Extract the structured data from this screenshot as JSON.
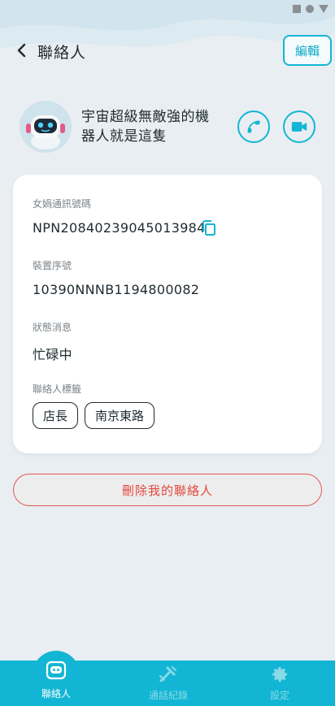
{
  "header": {
    "title": "聯絡人",
    "edit_label": "編輯"
  },
  "profile": {
    "name": "宇宙超級無敵強的機器人就是這隻"
  },
  "details": {
    "id_label": "女媧通訊號碼",
    "id_value": "NPN20840239045013984",
    "serial_label": "裝置序號",
    "serial_value": "10390NNNB1194800082",
    "status_label": "狀態消息",
    "status_value": "忙碌中",
    "tags_label": "聯絡人標籤",
    "tags": [
      "店長",
      "南京東路"
    ]
  },
  "delete_label": "刪除我的聯絡人",
  "nav": {
    "contacts_label": "聯絡人",
    "calls_label": "通話紀錄",
    "settings_label": "設定",
    "active": "contacts"
  },
  "colors": {
    "accent": "#12b6d4",
    "danger": "#e4463c",
    "background": "#e9eef2"
  },
  "icons": {
    "back": "chevron-left-icon",
    "phone": "phone-icon",
    "video": "video-camera-icon",
    "copy": "copy-icon",
    "contacts": "contacts-icon",
    "calls": "call-log-icon",
    "settings": "gear-icon"
  }
}
